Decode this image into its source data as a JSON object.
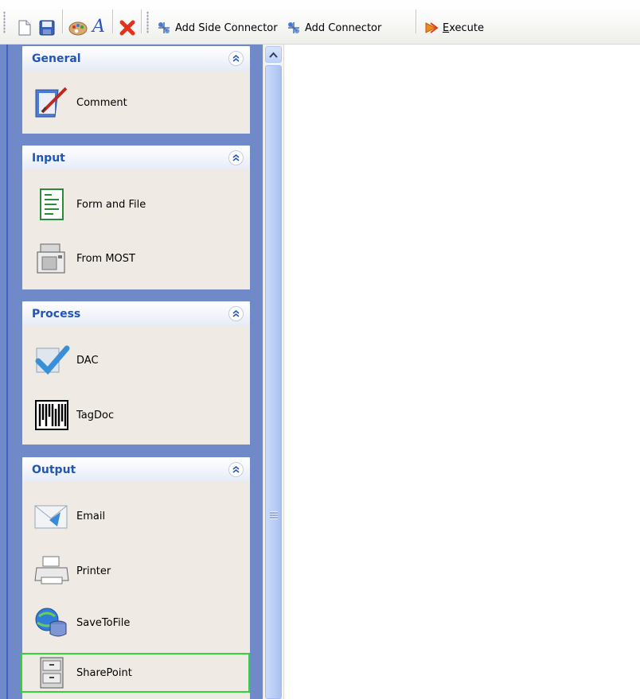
{
  "toolbar": {
    "icons": [
      "new-document-icon",
      "save-icon",
      "palette-icon",
      "font-icon",
      "delete-icon"
    ],
    "add_side_connector": "Add Side Connector",
    "add_connector": "Add Connector",
    "execute_prefix": "E",
    "execute_rest": "xecute"
  },
  "sidebar": {
    "groups": [
      {
        "title": "General",
        "items": [
          {
            "label": "Comment",
            "icon": "comment-icon"
          }
        ]
      },
      {
        "title": "Input",
        "items": [
          {
            "label": "Form and File",
            "icon": "form-icon"
          },
          {
            "label": "From MOST",
            "icon": "copier-icon"
          }
        ]
      },
      {
        "title": "Process",
        "items": [
          {
            "label": "DAC",
            "icon": "checkmark-icon"
          },
          {
            "label": "TagDoc",
            "icon": "barcode-icon"
          }
        ]
      },
      {
        "title": "Output",
        "items": [
          {
            "label": "Email",
            "icon": "email-icon"
          },
          {
            "label": "Printer",
            "icon": "printer-icon"
          },
          {
            "label": "SaveToFile",
            "icon": "globe-database-icon"
          },
          {
            "label": "SharePoint",
            "icon": "file-cabinet-icon"
          }
        ]
      }
    ]
  },
  "colors": {
    "header_text": "#2155b8",
    "sidebar_bg": "#6f89c9",
    "group_bg": "#efebe4",
    "selection": "#32d238"
  }
}
